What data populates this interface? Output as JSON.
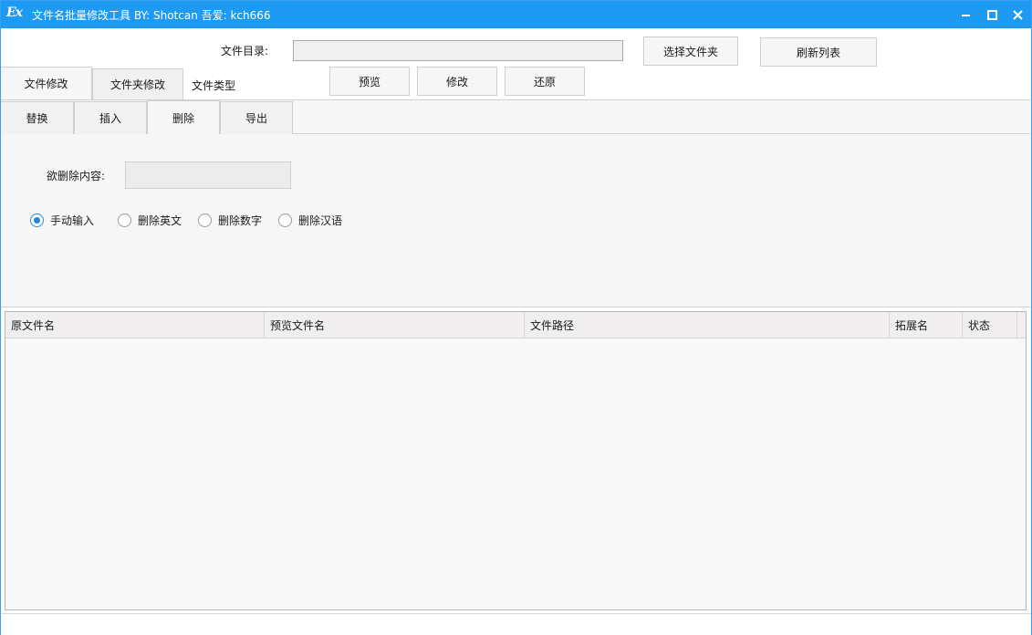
{
  "window": {
    "logo": "Ex",
    "title": "文件名批量修改工具 BY: Shotcan 吾爱: kch666",
    "controls": [
      "minimize-icon",
      "maximize-icon",
      "close-icon"
    ]
  },
  "toolbar": {
    "dir_label": "文件目录:",
    "dir_value": "",
    "select_folder": "选择文件夹",
    "refresh_list": "刷新列表",
    "preview": "预览",
    "modify": "修改",
    "restore": "还原"
  },
  "main_tabs": {
    "file": "文件修改",
    "folder": "文件夹修改",
    "type_label": "文件类型"
  },
  "sub_tabs": {
    "replace": "替换",
    "insert": "插入",
    "delete": "删除",
    "export": "导出",
    "active": "删除"
  },
  "delete_panel": {
    "content_label": "欲删除内容:",
    "content_value": "",
    "options": [
      {
        "label": "手动输入",
        "checked": true
      },
      {
        "label": "删除英文",
        "checked": false
      },
      {
        "label": "删除数字",
        "checked": false
      },
      {
        "label": "删除汉语",
        "checked": false
      }
    ]
  },
  "list": {
    "columns": [
      "原文件名",
      "预览文件名",
      "文件路径",
      "拓展名",
      "状态"
    ],
    "rows": []
  },
  "colors": {
    "titlebar": "#1e9af3",
    "radio_accent": "#1e8ad6"
  }
}
